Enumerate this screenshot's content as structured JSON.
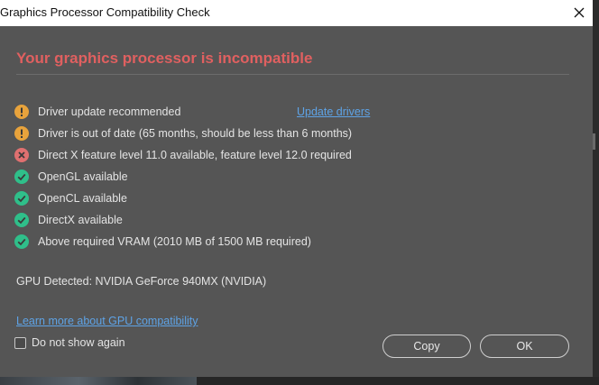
{
  "window": {
    "title": "Graphics Processor Compatibility Check"
  },
  "headline": "Your graphics processor is incompatible",
  "checks": [
    {
      "status": "warning",
      "text": "Driver update recommended",
      "link": "Update drivers"
    },
    {
      "status": "warning",
      "text": "Driver is out of date (65 months, should be less than 6 months)"
    },
    {
      "status": "error",
      "text": "Direct X feature level 11.0 available, feature level 12.0 required"
    },
    {
      "status": "ok",
      "text": "OpenGL available"
    },
    {
      "status": "ok",
      "text": "OpenCL available"
    },
    {
      "status": "ok",
      "text": "DirectX available"
    },
    {
      "status": "ok",
      "text": "Above required VRAM (2010 MB of 1500 MB required)"
    }
  ],
  "gpu_detected": "GPU Detected: NVIDIA GeForce 940MX (NVIDIA)",
  "learn_more": "Learn more about GPU compatibility",
  "dont_show": "Do not show again",
  "buttons": {
    "copy": "Copy",
    "ok": "OK"
  },
  "colors": {
    "warning": "#e8a33c",
    "error": "#e07070",
    "ok": "#2fbf8a",
    "headline": "#e06060",
    "link": "#5ea3e6"
  },
  "icons": {
    "warning": "exclamation-circle-icon",
    "error": "x-circle-icon",
    "ok": "checkmark-circle-icon",
    "close": "close-icon"
  }
}
